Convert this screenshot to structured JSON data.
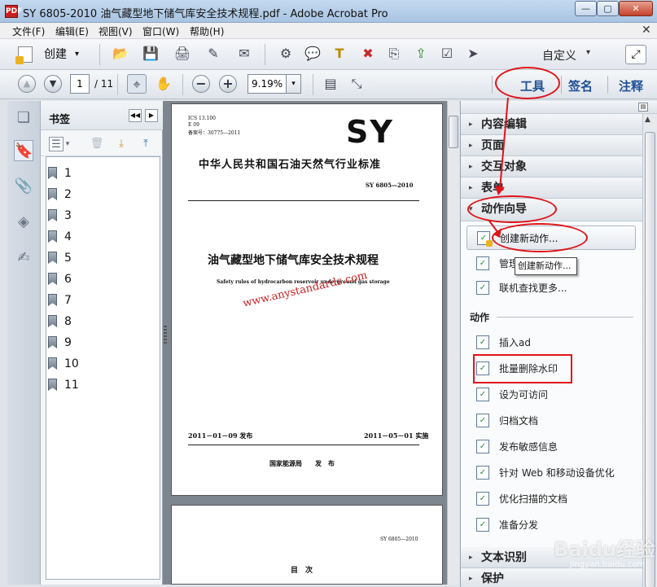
{
  "window": {
    "title": "SY 6805-2010 油气藏型地下储气库安全技术规程.pdf - Adobe Acrobat Pro",
    "min_glyph": "—",
    "max_glyph": "▢",
    "close_glyph": "✕",
    "app_icon_text": "PDF"
  },
  "menu": {
    "items": [
      "文件(F)",
      "编辑(E)",
      "视图(V)",
      "窗口(W)",
      "帮助(H)"
    ],
    "close_glyph": "✕"
  },
  "toolbar": {
    "create_label": "创建",
    "create_arrow": "▾",
    "customize_label": "自定义",
    "customize_arrow": "▾",
    "icons": {
      "open": "📂",
      "save": "💾",
      "print": "🖨",
      "edit": "✎",
      "email": "✉",
      "settings": "⚙",
      "comment": "💬",
      "highlight": "T",
      "delete": "✖",
      "combine": "⎘",
      "export": "⇪",
      "form": "☑",
      "pointer": "➤",
      "expand": "⤢",
      "prev": "▲",
      "next": "▼",
      "select": "⌖",
      "hand": "✋",
      "zoomout": "−",
      "zoomin": "+",
      "fitpage": "▤",
      "fitwidth": "⤡"
    }
  },
  "navigation": {
    "current_page": "1",
    "total_pages": "/ 11",
    "zoom": "9.19%",
    "zoom_arrow": "▾"
  },
  "tabs": {
    "tools": "工具",
    "sign": "签名",
    "comment": "注释"
  },
  "rail_icons": {
    "pages": "❏",
    "bookmarks": "🔖",
    "attachments": "📎",
    "layers": "◈",
    "signatures": "✍"
  },
  "bookmarks": {
    "title": "书签",
    "collapse": "◀◀",
    "expand": "▶",
    "tools": {
      "options": "☰",
      "options_arrow": "▾",
      "delete": "🗑",
      "add": "⤓",
      "promote": "⤒"
    },
    "items": [
      "1",
      "2",
      "3",
      "4",
      "5",
      "6",
      "7",
      "8",
      "9",
      "10",
      "11"
    ]
  },
  "document": {
    "page1": {
      "ics": "ICS 13.100",
      "code": "E 09",
      "reg": "备案号：30775—2011",
      "logo": "SY",
      "org": "中华人民共和国石油天然气行业标准",
      "number": "SY 6805—2010",
      "title_cn": "油气藏型地下储气库安全技术规程",
      "title_en": "Safety rules of hydrocarbon reservoir underground gas storage",
      "watermark": "www.anystandards.com",
      "issued": "2011－01－09 发布",
      "effective": "2011－05－01 实施",
      "publisher": "国家能源局　　发　布"
    },
    "page2": {
      "number": "SY 6805—2010",
      "toc": "目　次"
    }
  },
  "tools_panel": {
    "options": "▤",
    "sections": [
      "内容编辑",
      "页面",
      "交互对象",
      "表单",
      "动作向导"
    ],
    "collapsed_glyph": "▸",
    "expanded_glyph": "▾",
    "wizard_items": {
      "create": "创建新动作...",
      "manage": "管理",
      "online": "联机查找更多..."
    },
    "tooltip": "创建新动作...",
    "actions_heading": "动作",
    "actions": [
      "插入ad",
      "批量删除水印",
      "设为可访问",
      "归档文档",
      "发布敏感信息",
      "针对 Web 和移动设备优化",
      "优化扫描的文档",
      "准备分发"
    ],
    "bottom_sections": [
      "文本识别",
      "保护"
    ],
    "action_icon": "✓"
  },
  "colors": {
    "annotation": "#e0141a",
    "tab_text": "#1f4f95"
  },
  "watermark": {
    "brand": "Baidu经验",
    "url": "jingyan.baidu.com"
  }
}
